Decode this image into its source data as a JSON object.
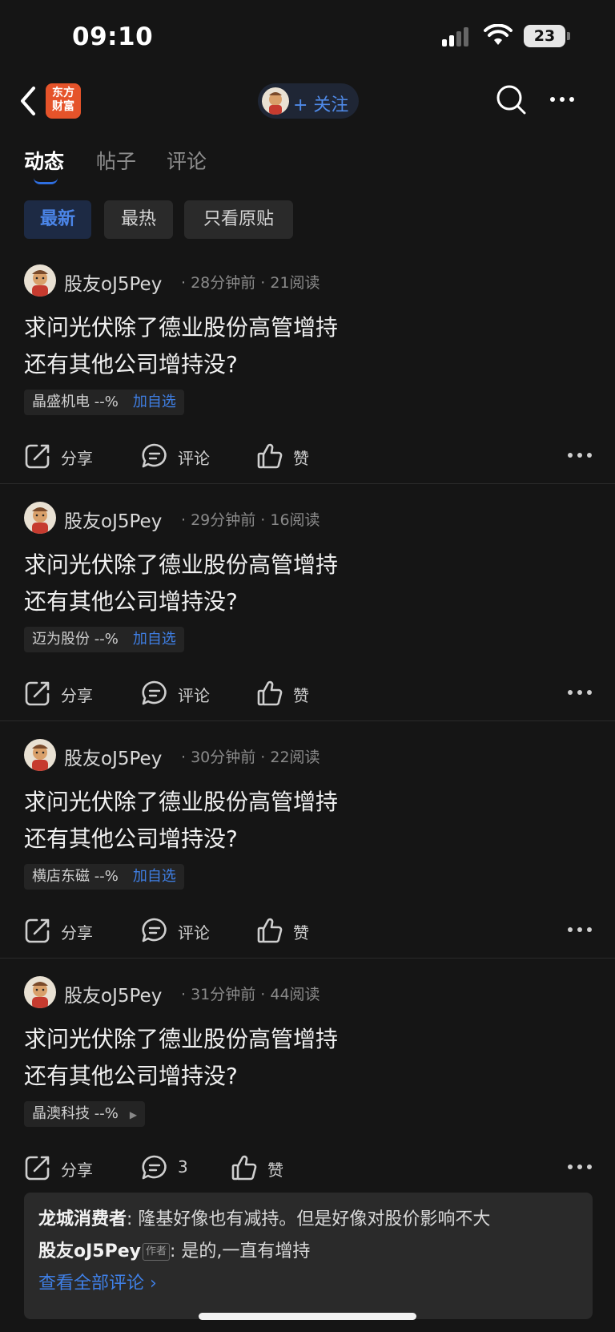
{
  "status": {
    "time": "09:10",
    "battery": "23"
  },
  "nav": {
    "logo_text": "东方财富",
    "follow_label": "+ 关注"
  },
  "tabs": [
    {
      "label": "动态"
    },
    {
      "label": "帖子"
    },
    {
      "label": "评论"
    }
  ],
  "filters": [
    {
      "label": "最新"
    },
    {
      "label": "最热"
    },
    {
      "label": "只看原贴"
    }
  ],
  "posts": [
    {
      "author": "股友oJ5Pey",
      "meta": "· 28分钟前 · 21阅读",
      "body_line1": "求问光伏除了德业股份高管增持",
      "body_line2": "还有其他公司增持没?",
      "stock": "晶盛机电 --%",
      "stock_action": "加自选",
      "share": "分享",
      "comment": "评论",
      "like": "赞"
    },
    {
      "author": "股友oJ5Pey",
      "meta": "· 29分钟前 · 16阅读",
      "body_line1": "求问光伏除了德业股份高管增持",
      "body_line2": "还有其他公司增持没?",
      "stock": "迈为股份 --%",
      "stock_action": "加自选",
      "share": "分享",
      "comment": "评论",
      "like": "赞"
    },
    {
      "author": "股友oJ5Pey",
      "meta": "· 30分钟前 · 22阅读",
      "body_line1": "求问光伏除了德业股份高管增持",
      "body_line2": "还有其他公司增持没?",
      "stock": "横店东磁 --%",
      "stock_action": "加自选",
      "share": "分享",
      "comment": "评论",
      "like": "赞"
    },
    {
      "author": "股友oJ5Pey",
      "meta": "· 31分钟前 · 44阅读",
      "body_line1": "求问光伏除了德业股份高管增持",
      "body_line2": "还有其他公司增持没?",
      "stock": "晶澳科技 --%",
      "share": "分享",
      "comment": "3",
      "like": "赞"
    }
  ],
  "comments": {
    "c1_author": "龙城消费者",
    "c1_text": ":  隆基好像也有减持。但是好像对股价影响不大",
    "c2_author": "股友oJ5Pey",
    "c2_badge": "作者",
    "c2_text": ":  是的,一直有增持",
    "view_all": "查看全部评论 ›"
  }
}
